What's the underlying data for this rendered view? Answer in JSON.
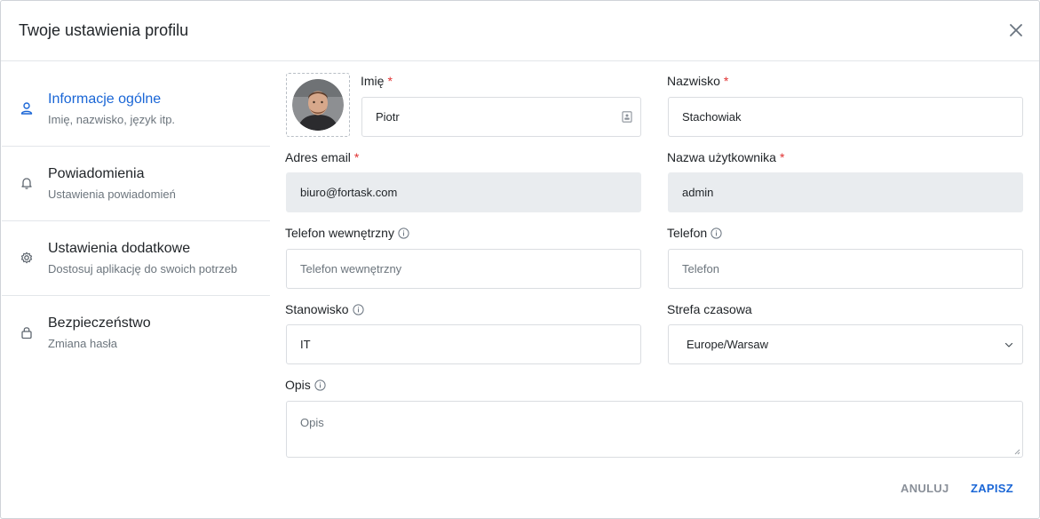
{
  "dialog": {
    "title": "Twoje ustawienia profilu"
  },
  "sidebar": {
    "items": [
      {
        "label": "Informacje ogólne",
        "sub": "Imię, nazwisko, język itp.",
        "icon": "user-icon",
        "active": true
      },
      {
        "label": "Powiadomienia",
        "sub": "Ustawienia powiadomień",
        "icon": "bell-icon"
      },
      {
        "label": "Ustawienia dodatkowe",
        "sub": "Dostosuj aplikację do swoich potrzeb",
        "icon": "gear-icon"
      },
      {
        "label": "Bezpieczeństwo",
        "sub": "Zmiana hasła",
        "icon": "lock-icon"
      }
    ]
  },
  "form": {
    "first_name": {
      "label": "Imię",
      "required": "*",
      "value": "Piotr"
    },
    "last_name": {
      "label": "Nazwisko",
      "required": "*",
      "value": "Stachowiak"
    },
    "email": {
      "label": "Adres email",
      "required": "*",
      "value": "biuro@fortask.com"
    },
    "username": {
      "label": "Nazwa użytkownika",
      "required": "*",
      "value": "admin"
    },
    "extension": {
      "label": "Telefon wewnętrzny",
      "placeholder": "Telefon wewnętrzny"
    },
    "phone": {
      "label": "Telefon",
      "placeholder": "Telefon"
    },
    "position": {
      "label": "Stanowisko",
      "value": "IT"
    },
    "timezone": {
      "label": "Strefa czasowa",
      "value": "Europe/Warsaw"
    },
    "description": {
      "label": "Opis",
      "placeholder": "Opis"
    }
  },
  "buttons": {
    "cancel": "ANULUJ",
    "save": "ZAPISZ"
  },
  "colors": {
    "accent": "#1a66d6",
    "required": "#e03131",
    "disabled_bg": "#e9ecef"
  }
}
